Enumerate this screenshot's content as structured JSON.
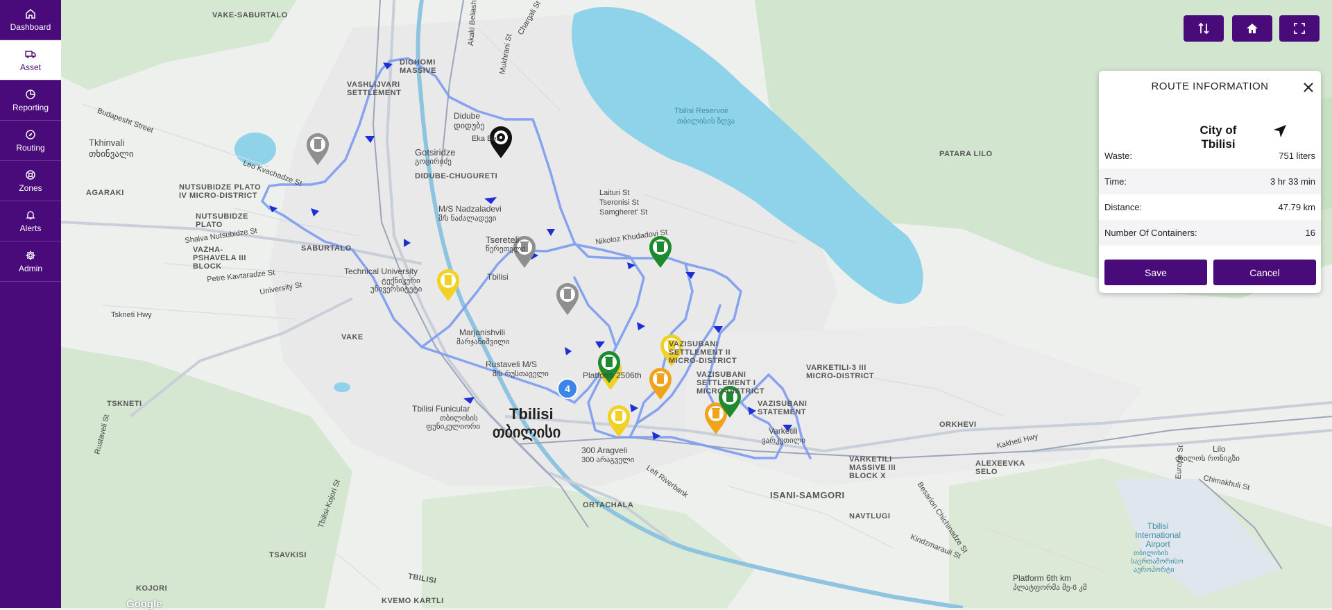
{
  "sidebar": {
    "items": [
      {
        "label": "Dashboard",
        "icon": "home-icon"
      },
      {
        "label": "Asset",
        "icon": "truck-icon"
      },
      {
        "label": "Reporting",
        "icon": "pie-chart-icon"
      },
      {
        "label": "Routing",
        "icon": "compass-icon"
      },
      {
        "label": "Zones",
        "icon": "zones-icon"
      },
      {
        "label": "Alerts",
        "icon": "bell-icon"
      },
      {
        "label": "Admin",
        "icon": "gear-icon"
      }
    ],
    "active_index": 1
  },
  "toolbar": {
    "icons": [
      "route-swap-icon",
      "home-icon",
      "fullscreen-icon"
    ]
  },
  "route_panel": {
    "title": "ROUTE INFORMATION",
    "city": "City of Tbilisi",
    "rows": [
      {
        "label": "Waste:",
        "value": "751 liters"
      },
      {
        "label": "Time:",
        "value": "3 hr 33 min"
      },
      {
        "label": "Distance:",
        "value": "47.79 km"
      },
      {
        "label": "Number Of Containers:",
        "value": "16"
      }
    ],
    "save_label": "Save",
    "cancel_label": "Cancel"
  },
  "map": {
    "labels": [
      {
        "text": "VAKE-SABURTALO"
      },
      {
        "text": "DIGHOMI MASSIVE"
      },
      {
        "text": "VASHLIJVARI SETTLEMENT"
      },
      {
        "text": "Budapesht Street"
      },
      {
        "text": "Tkhinvali"
      },
      {
        "text": "თხინვალი"
      },
      {
        "text": "Leo Kvachadze St"
      },
      {
        "text": "Didube"
      },
      {
        "text": "დიდუბე"
      },
      {
        "text": "Gotsiridze"
      },
      {
        "text": "გოცირიძე"
      },
      {
        "text": "DIDUBE-CHUGURETI"
      },
      {
        "text": "NUTSUBIDZE PLATO IV MICRO-DISTRICT"
      },
      {
        "text": "AGARAKI"
      },
      {
        "text": "NUTSUBIDZE PLATO"
      },
      {
        "text": "Shalva Nutsubidze St"
      },
      {
        "text": "VAZHA-PSHAVELA III BLOCK"
      },
      {
        "text": "SABURTALO"
      },
      {
        "text": "M/S Nadzaladevi"
      },
      {
        "text": "მ/ს ნაძალადევი"
      },
      {
        "text": "Tsereteli"
      },
      {
        "text": "წერეთელი"
      },
      {
        "text": "Technical University"
      },
      {
        "text": "ტექნიკური"
      },
      {
        "text": "უნივერსიტეტი"
      },
      {
        "text": "Petre Kavtaradze St"
      },
      {
        "text": "University St"
      },
      {
        "text": "Tbilisi"
      },
      {
        "text": "Tskneti Hwy"
      },
      {
        "text": "VAKE"
      },
      {
        "text": "Marjanishvili"
      },
      {
        "text": "მარჯანიშვილი"
      },
      {
        "text": "Rustaveli M/S"
      },
      {
        "text": "მ/ს რუსთაველი"
      },
      {
        "text": "TSKNETI"
      },
      {
        "text": "Tbilisi Funicular"
      },
      {
        "text": "თბილისის"
      },
      {
        "text": "ფუნიკულიორი"
      },
      {
        "text": "Tbilisi"
      },
      {
        "text": "თბილისი"
      },
      {
        "text": "300 Aragveli"
      },
      {
        "text": "300 არაგველი"
      },
      {
        "text": "Left Riverbank"
      },
      {
        "text": "ORTACHALA"
      },
      {
        "text": "TSAVKISI"
      },
      {
        "text": "KOJORI"
      },
      {
        "text": "TBILISI"
      },
      {
        "text": "KVEMO KARTLI"
      },
      {
        "text": "Tbilisi Reservoir"
      },
      {
        "text": "თბილისის ზღვა"
      },
      {
        "text": "Laituri St"
      },
      {
        "text": "Tseronisi St"
      },
      {
        "text": "Samgheret' St"
      },
      {
        "text": "Nikoloz Khudadovi St"
      },
      {
        "text": "PATARA LILO"
      },
      {
        "text": "VAZISUBANI SETTLEMENT II MICRO-DISTRICT"
      },
      {
        "text": "VAZISUBANI SETTLEMENT I MICRO-DISTRICT"
      },
      {
        "text": "VAZISUBANI STATEMENT"
      },
      {
        "text": "VARKETILI-3 III MICRO-DISTRICT"
      },
      {
        "text": "Varketili"
      },
      {
        "text": "ვარკეთილი"
      },
      {
        "text": "VARKETILI MASSIVE III BLOCK X"
      },
      {
        "text": "ORKHEVI"
      },
      {
        "text": "Kakheti Hwy"
      },
      {
        "text": "ALEXEEVKA SELO"
      },
      {
        "text": "Lilo"
      },
      {
        "text": "ლილოს რონიგზი"
      },
      {
        "text": "ISANI-SAMGORI"
      },
      {
        "text": "NAVTLUGI"
      },
      {
        "text": "Kindzmarauli St"
      },
      {
        "text": "Platform 6th km"
      },
      {
        "text": "პლატფორმა მე-6 კმ"
      },
      {
        "text": "Tbilisi International Airport"
      },
      {
        "text": "თბილისის"
      },
      {
        "text": "საერთაშორისო"
      },
      {
        "text": "აეროპორტი"
      },
      {
        "text": "Platform 2506th"
      },
      {
        "text": "Chimakhuli St"
      },
      {
        "text": "Besarion Chichinadze St"
      },
      {
        "text": "Rustaveli St"
      },
      {
        "text": "Tbilisi-Kojori St"
      },
      {
        "text": "Mukhrani St"
      },
      {
        "text": "Chargali St"
      },
      {
        "text": "Akaki Beliashvili St"
      },
      {
        "text": "Europe St"
      },
      {
        "text": "Eka Bes"
      },
      {
        "text": "4"
      },
      {
        "text": "Google"
      }
    ],
    "colors": {
      "route": "#7b9cf0",
      "route_dark": "#1e2fd6",
      "water": "#8fd3ea",
      "park": "#d2e6cf",
      "land": "#eef0ee",
      "pin_gray": "#8f8f8f",
      "pin_yellow": "#f2d024",
      "pin_orange": "#f2a31c",
      "pin_green": "#1e8a2e",
      "pin_black": "#111111",
      "cluster": "#3b86e8"
    },
    "pins": [
      {
        "color": "gray",
        "type": "trash-icon"
      },
      {
        "color": "gray",
        "type": "trash-icon"
      },
      {
        "color": "gray",
        "type": "trash-icon"
      },
      {
        "color": "yellow",
        "type": "trash-icon"
      },
      {
        "color": "yellow",
        "type": "trash-icon"
      },
      {
        "color": "yellow",
        "type": "trash-icon"
      },
      {
        "color": "yellow",
        "type": "trash-icon"
      },
      {
        "color": "orange",
        "type": "trash-icon"
      },
      {
        "color": "orange",
        "type": "trash-icon"
      },
      {
        "color": "green",
        "type": "trash-icon"
      },
      {
        "color": "green",
        "type": "trash-icon"
      },
      {
        "color": "green",
        "type": "trash-icon"
      },
      {
        "color": "black",
        "type": "depot-icon"
      }
    ]
  }
}
